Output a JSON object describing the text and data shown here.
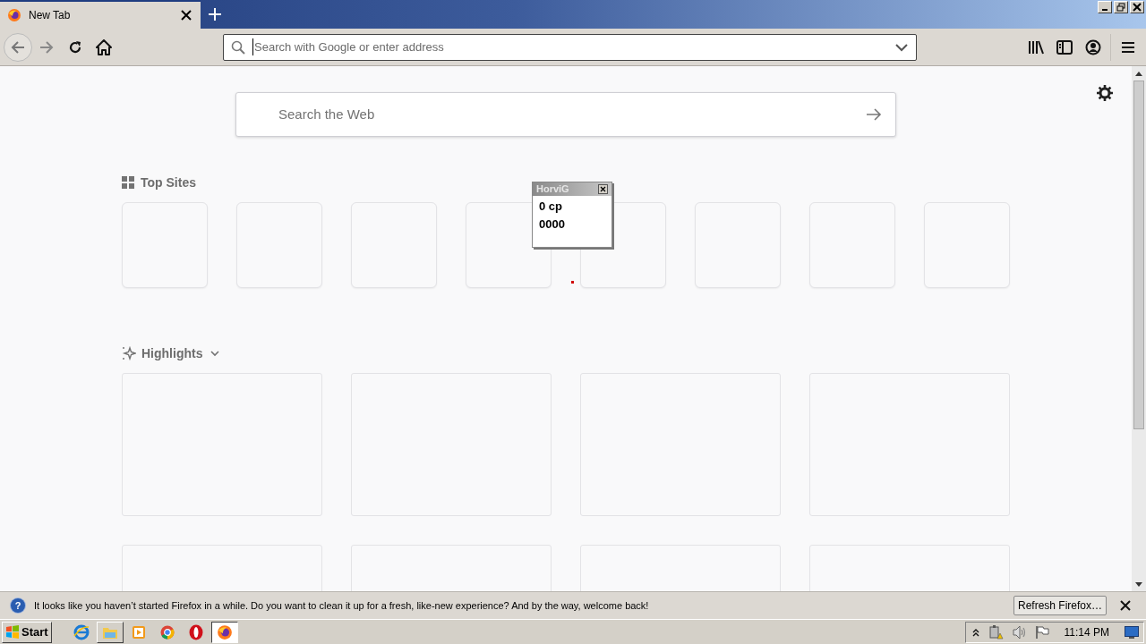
{
  "tabs": [
    {
      "title": "New Tab",
      "selected": true
    }
  ],
  "urlbar": {
    "placeholder": "Search with Google or enter address"
  },
  "search": {
    "placeholder": "Search the Web"
  },
  "top_sites": {
    "title": "Top Sites"
  },
  "highlights": {
    "title": "Highlights"
  },
  "popup": {
    "title": "HorviG",
    "lines": [
      "0 cp",
      "0000"
    ]
  },
  "notification": {
    "icon": "?",
    "text": "It looks like you haven’t started Firefox in a while. Do you want to clean it up for a fresh, like-new experience? And by the way, welcome back!",
    "button": "Refresh Firefox…"
  },
  "taskbar": {
    "start": "Start",
    "apps": [
      {
        "kind": "ebrowser",
        "running": false,
        "selected": false
      },
      {
        "kind": "folder",
        "running": true,
        "selected": false
      },
      {
        "kind": "media",
        "running": false,
        "selected": false
      },
      {
        "kind": "ring",
        "running": false,
        "selected": false
      },
      {
        "kind": "ocircle",
        "running": false,
        "selected": false
      },
      {
        "kind": "fox",
        "running": true,
        "selected": true
      }
    ],
    "clock": "11:14 PM"
  }
}
